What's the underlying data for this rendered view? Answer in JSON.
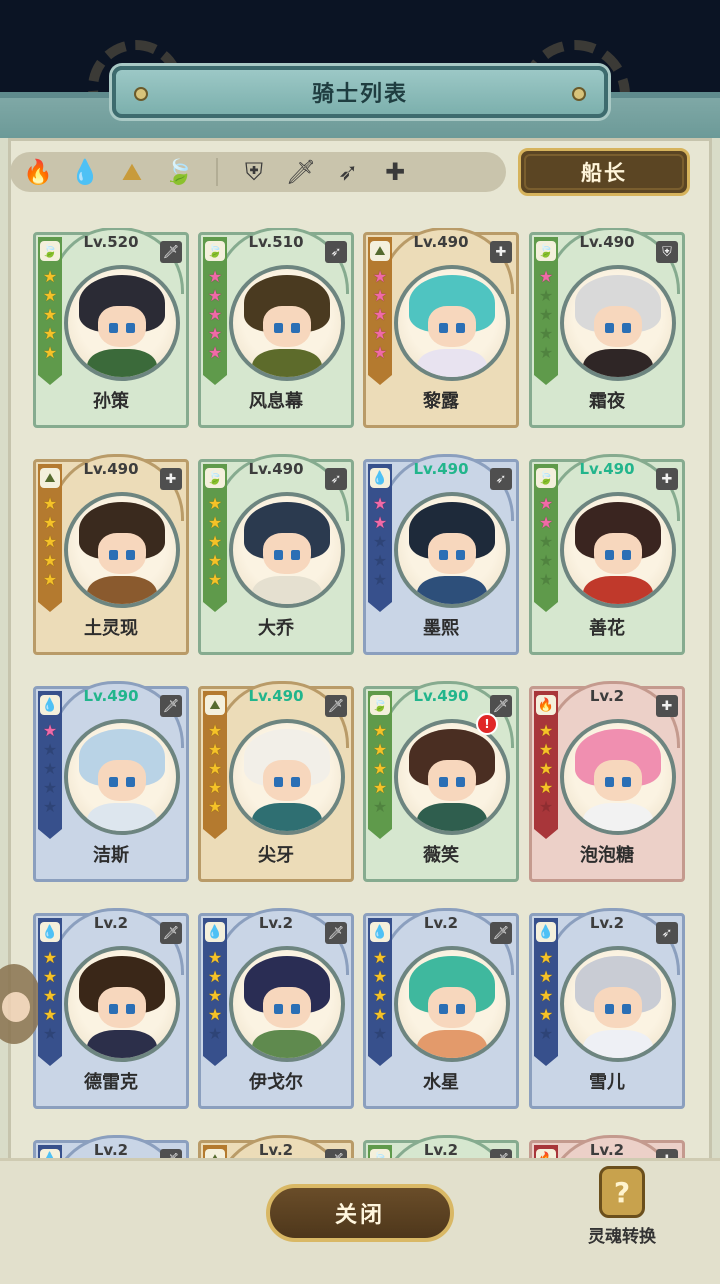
{
  "title": "骑士列表",
  "captain_label": "船长",
  "close_label": "关闭",
  "soul_convert_label": "灵魂转换",
  "soul_convert_icon": "?",
  "filters": {
    "elements": [
      {
        "icon": "fire-icon",
        "glyph": "🔥",
        "color": "#c73a32"
      },
      {
        "icon": "water-icon",
        "glyph": "💧",
        "color": "#3a77c9"
      },
      {
        "icon": "earth-icon",
        "glyph": "⛰",
        "color": "#c89b3b"
      },
      {
        "icon": "wind-icon",
        "glyph": "🍃",
        "color": "#7aa84a"
      }
    ],
    "classes": [
      {
        "icon": "shield-icon",
        "glyph": "⛨"
      },
      {
        "icon": "sword-icon",
        "glyph": "🗡"
      },
      {
        "icon": "bow-icon",
        "glyph": "➶"
      },
      {
        "icon": "cross-icon",
        "glyph": "✚"
      }
    ]
  },
  "knights": [
    {
      "name": "孙策",
      "level": "Lv.520",
      "hi": false,
      "theme": "green",
      "element": "wind",
      "stars": 5,
      "star_color": "gold",
      "class": "sword",
      "hair": "#2b2b35",
      "body": "#3b6a3a"
    },
    {
      "name": "风息幕",
      "level": "Lv.510",
      "hi": false,
      "theme": "green",
      "element": "wind",
      "stars": 5,
      "star_color": "pink",
      "class": "bow",
      "hair": "#4a3a20",
      "body": "#5d6b2b"
    },
    {
      "name": "黎露",
      "level": "Lv.490",
      "hi": false,
      "theme": "gold",
      "element": "earth",
      "stars": 5,
      "star_color": "pink",
      "class": "cross",
      "hair": "#4fc4c1",
      "body": "#e8e3f0"
    },
    {
      "name": "霜夜",
      "level": "Lv.490",
      "hi": false,
      "theme": "green",
      "element": "wind",
      "stars": 1,
      "star_color": "pink",
      "class": "shield",
      "hair": "#d9d9d9",
      "body": "#2f2626"
    },
    {
      "name": "土灵现",
      "level": "Lv.490",
      "hi": false,
      "theme": "gold",
      "element": "earth",
      "stars": 5,
      "star_color": "gold",
      "class": "cross",
      "hair": "#3a2a1e",
      "body": "#8a5a2e"
    },
    {
      "name": "大乔",
      "level": "Lv.490",
      "hi": false,
      "theme": "green",
      "element": "wind",
      "stars": 5,
      "star_color": "gold",
      "class": "bow",
      "hair": "#2b3a4f",
      "body": "#e5e0d0"
    },
    {
      "name": "墨熙",
      "level": "Lv.490",
      "hi": true,
      "theme": "blue",
      "element": "water",
      "stars": 2,
      "star_color": "pink",
      "class": "bow",
      "hair": "#1e2a3a",
      "body": "#2d4f7a"
    },
    {
      "name": "善花",
      "level": "Lv.490",
      "hi": true,
      "theme": "green",
      "element": "wind",
      "stars": 2,
      "star_color": "pink",
      "class": "cross",
      "hair": "#3a2520",
      "body": "#c0392b"
    },
    {
      "name": "洁斯",
      "level": "Lv.490",
      "hi": true,
      "theme": "blue",
      "element": "water",
      "stars": 1,
      "star_color": "pink",
      "class": "sword",
      "hair": "#b9d3e6",
      "body": "#dde6ee"
    },
    {
      "name": "尖牙",
      "level": "Lv.490",
      "hi": true,
      "theme": "gold",
      "element": "earth",
      "stars": 5,
      "star_color": "gold",
      "class": "sword",
      "hair": "#f2efe8",
      "body": "#2f6f72"
    },
    {
      "name": "薇笑",
      "level": "Lv.490",
      "hi": true,
      "theme": "green",
      "element": "wind",
      "stars": 4,
      "star_color": "gold",
      "class": "sword",
      "hair": "#4a2e22",
      "body": "#2f5e4e",
      "notification": "!"
    },
    {
      "name": "泡泡糖",
      "level": "Lv.2",
      "hi": false,
      "theme": "red",
      "element": "fire",
      "stars": 4,
      "star_color": "gold",
      "class": "cross",
      "hair": "#f08fb0",
      "body": "#f2f2f2"
    },
    {
      "name": "德雷克",
      "level": "Lv.2",
      "hi": false,
      "theme": "blue",
      "element": "water",
      "stars": 4,
      "star_color": "gold",
      "class": "sword",
      "hair": "#3a2718",
      "body": "#2c2f4a"
    },
    {
      "name": "伊戈尔",
      "level": "Lv.2",
      "hi": false,
      "theme": "blue",
      "element": "water",
      "stars": 4,
      "star_color": "gold",
      "class": "sword",
      "hair": "#2a2d54",
      "body": "#5f8a4e"
    },
    {
      "name": "水星",
      "level": "Lv.2",
      "hi": false,
      "theme": "blue",
      "element": "water",
      "stars": 4,
      "star_color": "gold",
      "class": "sword",
      "hair": "#3fb89e",
      "body": "#e39a6b"
    },
    {
      "name": "雪儿",
      "level": "Lv.2",
      "hi": false,
      "theme": "blue",
      "element": "water",
      "stars": 4,
      "star_color": "gold",
      "class": "bow",
      "hair": "#c9ccd4",
      "body": "#eef0f5"
    },
    {
      "name": "",
      "level": "Lv.2",
      "hi": false,
      "theme": "blue",
      "element": "water",
      "stars": 0,
      "star_color": "gold",
      "class": "sword",
      "hair": "#555",
      "body": "#777"
    },
    {
      "name": "",
      "level": "Lv.2",
      "hi": false,
      "theme": "gold",
      "element": "earth",
      "stars": 0,
      "star_color": "gold",
      "class": "sword",
      "hair": "#555",
      "body": "#777"
    },
    {
      "name": "",
      "level": "Lv.2",
      "hi": false,
      "theme": "green",
      "element": "wind",
      "stars": 0,
      "star_color": "gold",
      "class": "sword",
      "hair": "#555",
      "body": "#777"
    },
    {
      "name": "",
      "level": "Lv.2",
      "hi": false,
      "theme": "red",
      "element": "fire",
      "stars": 0,
      "star_color": "gold",
      "class": "cross",
      "hair": "#555",
      "body": "#777"
    }
  ]
}
